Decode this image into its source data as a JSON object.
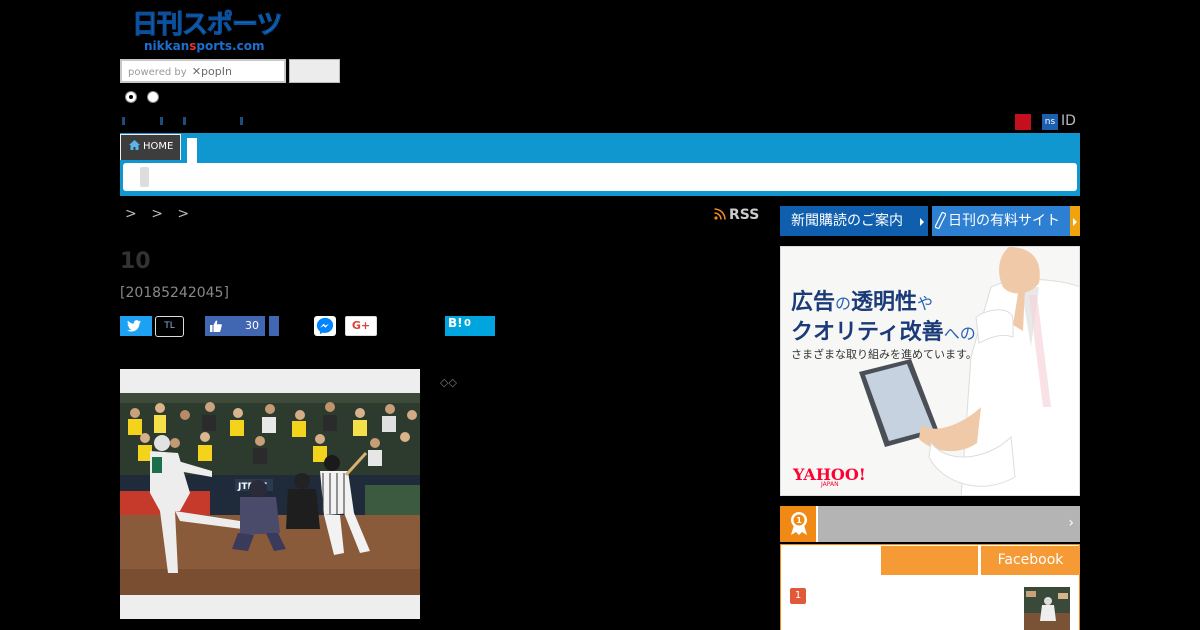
{
  "header": {
    "logo_text": "日刊スポーツ",
    "logo_domain_a": "nikkan",
    "logo_domain_b": "s",
    "logo_domain_c": "ports.com",
    "search_powered": "powered by",
    "search_brand": "popIn",
    "ns_badge": "ns",
    "id_label": "ID"
  },
  "nav": {
    "home_label": "HOME"
  },
  "breadcrumb": {
    "items": [
      ">",
      ">",
      ">"
    ]
  },
  "rss_label": "RSS",
  "article": {
    "title": "10",
    "date": "[20185242045]",
    "tl_label": "TL",
    "fb_count": "30",
    "gplus_label": "G+",
    "hatena_label": "B!",
    "hatena_count": "0",
    "diamonds": "◇◇"
  },
  "sidebar": {
    "subscribe_label": "新聞購読のご案内",
    "paid_label": "日刊の有料サイト",
    "ad": {
      "line1_a": "広告",
      "line1_b": "の",
      "line1_c": "透明性",
      "line1_d": "や",
      "line2_a": "クオリティ改善",
      "line2_b": "への",
      "line3": "さまざまな取り組みを進めています。",
      "brand": "YAHOO!",
      "brand_sub": "JAPAN"
    },
    "ranking": {
      "tab_facebook": "Facebook",
      "first_rank": "1"
    }
  },
  "colors": {
    "nav_blue": "#1097cf",
    "ranking_orange": "#f08a14",
    "subscribe_blue": "#0f5fae",
    "paid_blue": "#2d7fd1"
  }
}
